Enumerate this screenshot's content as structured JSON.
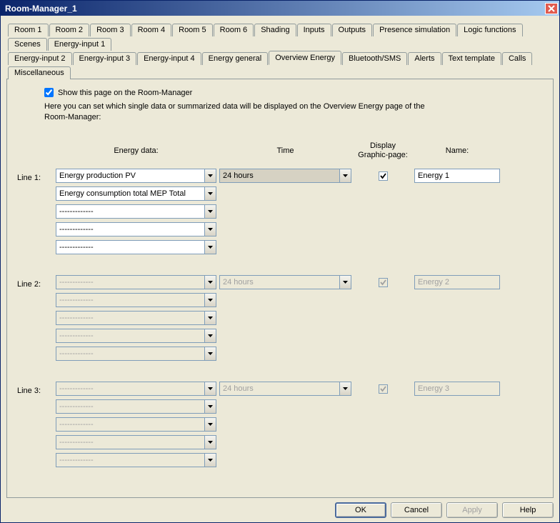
{
  "window": {
    "title": "Room-Manager_1"
  },
  "tabs_row1": [
    "Room 1",
    "Room 2",
    "Room 3",
    "Room 4",
    "Room 5",
    "Room 6",
    "Shading",
    "Inputs",
    "Outputs",
    "Presence simulation",
    "Logic functions",
    "Scenes",
    "Energy-input 1"
  ],
  "tabs_row2": [
    "Energy-input 2",
    "Energy-input 3",
    "Energy-input 4",
    "Energy general",
    "Overview Energy",
    "Bluetooth/SMS",
    "Alerts",
    "Text template",
    "Calls",
    "Miscellaneous"
  ],
  "active_tab": "Overview Energy",
  "show_page_label": "Show this page on the Room-Manager",
  "show_page_checked": true,
  "helptext": "Here you can set which single data or summarized data will be displayed on the Overview Energy page of the Room-Manager:",
  "headers": {
    "energy_data": "Energy data:",
    "time": "Time",
    "display": "Display Graphic-page:",
    "name": "Name:"
  },
  "lines": [
    {
      "label": "Line 1:",
      "enabled": true,
      "data": [
        "Energy production PV",
        "Energy consumption total MEP Total",
        "-------------",
        "-------------",
        "-------------"
      ],
      "time": "24 hours",
      "display_checked": true,
      "name": "Energy 1"
    },
    {
      "label": "Line 2:",
      "enabled": false,
      "data": [
        "-------------",
        "-------------",
        "-------------",
        "-------------",
        "-------------"
      ],
      "time": "24 hours",
      "display_checked": true,
      "name": "Energy 2"
    },
    {
      "label": "Line 3:",
      "enabled": false,
      "data": [
        "-------------",
        "-------------",
        "-------------",
        "-------------",
        "-------------"
      ],
      "time": "24 hours",
      "display_checked": true,
      "name": "Energy 3"
    }
  ],
  "buttons": {
    "ok": "OK",
    "cancel": "Cancel",
    "apply": "Apply",
    "help": "Help"
  }
}
